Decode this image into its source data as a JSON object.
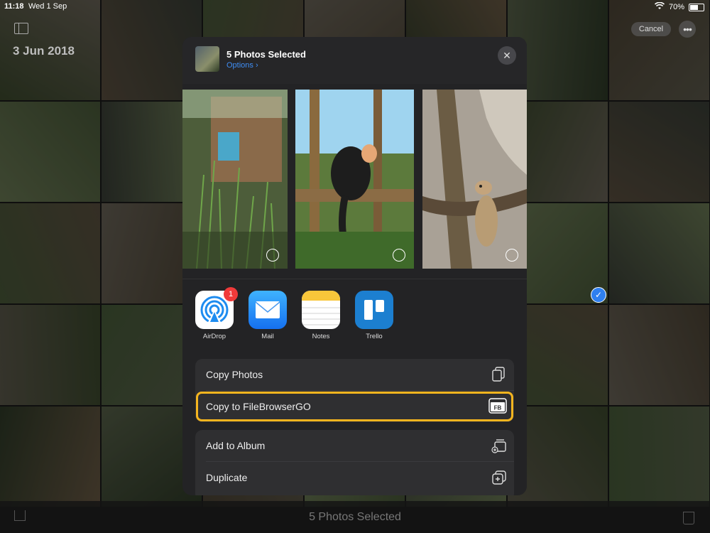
{
  "status": {
    "time": "11:18",
    "date": "Wed 1 Sep",
    "battery": "70%",
    "battery_level": 0.7
  },
  "library": {
    "date_header": "3 Jun 2018",
    "cancel_label": "Cancel",
    "more_label": "•••"
  },
  "bottom_bar": {
    "title": "5 Photos Selected"
  },
  "sheet": {
    "title": "5 Photos Selected",
    "options_label": "Options ›",
    "apps": [
      {
        "label": "AirDrop",
        "badge": "1"
      },
      {
        "label": "Mail"
      },
      {
        "label": "Notes"
      },
      {
        "label": "Trello"
      }
    ],
    "actions_group1": [
      {
        "label": "Copy Photos"
      },
      {
        "label": "Copy to FileBrowserGO"
      }
    ],
    "actions_group2": [
      {
        "label": "Add to Album"
      },
      {
        "label": "Duplicate"
      }
    ]
  },
  "colors": {
    "accent": "#3f8ef5",
    "highlight": "#f5b51f",
    "badge": "#f03a3a"
  }
}
